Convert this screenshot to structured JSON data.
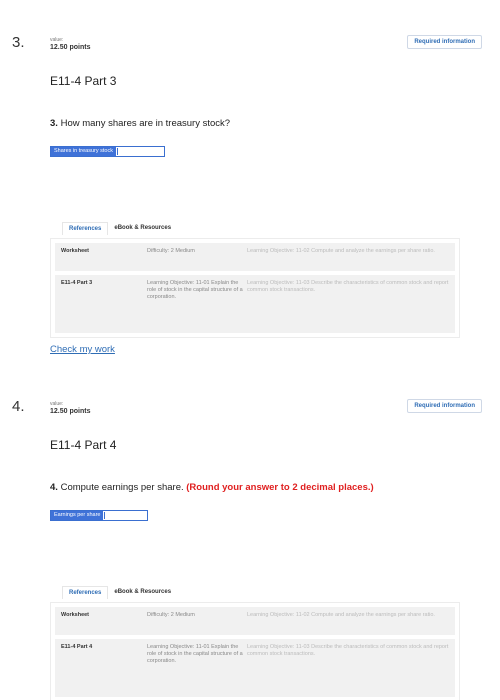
{
  "questions": [
    {
      "number": "3.",
      "value_label": "value:",
      "points": "12.50 points",
      "required_badge": "Required information",
      "part_title": "E11-4 Part 3",
      "question_number": "3.",
      "question_text": "How many shares are in treasury stock?",
      "question_emphasis": "",
      "input_label": "Shares in treasury stock",
      "input_value": "",
      "tabs": [
        "References",
        "eBook & Resources"
      ],
      "rows": [
        {
          "c1": "Worksheet",
          "c2": "Difficulty: 2 Medium",
          "c3": "Learning Objective: 11-02 Compute and analyze the earnings per share ratio."
        },
        {
          "c1": "E11-4 Part 3",
          "c2": "Learning Objective: 11-01 Explain the role of stock in the capital structure of a corporation.",
          "c3": "Learning Objective: 11-03 Describe the characteristics of common stock and report common stock transactions."
        }
      ],
      "check_link": "Check my work"
    },
    {
      "number": "4.",
      "value_label": "value:",
      "points": "12.50 points",
      "required_badge": "Required information",
      "part_title": "E11-4 Part 4",
      "question_number": "4.",
      "question_text": "Compute earnings per share.",
      "question_emphasis": "(Round your answer to 2 decimal places.)",
      "input_label": "Earnings per share",
      "input_value": "",
      "tabs": [
        "References",
        "eBook & Resources"
      ],
      "rows": [
        {
          "c1": "Worksheet",
          "c2": "Difficulty: 2 Medium",
          "c3": "Learning Objective: 11-02 Compute and analyze the earnings per share ratio."
        },
        {
          "c1": "E11-4 Part 4",
          "c2": "Learning Objective: 11-01 Explain the role of stock in the capital structure of a corporation.",
          "c3": "Learning Objective: 11-03 Describe the characteristics of common stock and report common stock transactions."
        }
      ]
    }
  ]
}
